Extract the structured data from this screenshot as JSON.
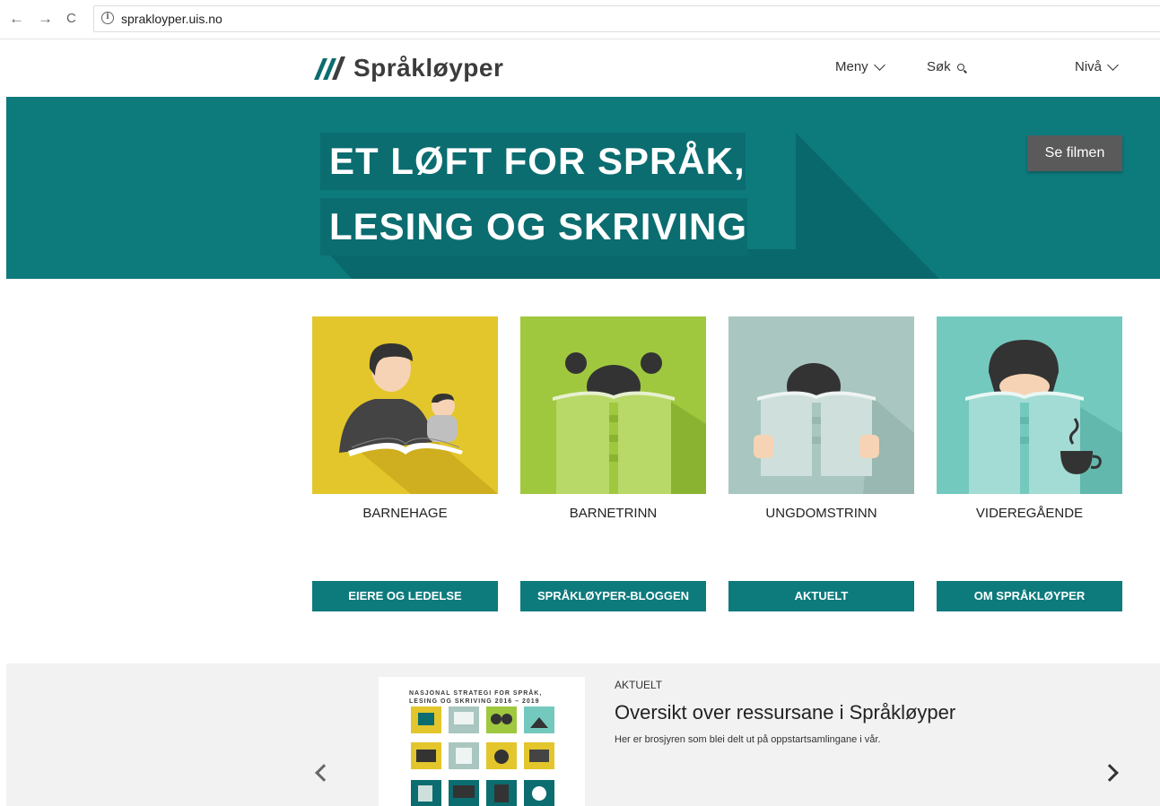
{
  "browser": {
    "back": "←",
    "forward": "→",
    "reload": "C",
    "url": "sprakloyper.uis.no"
  },
  "header": {
    "logo_text": "Språkløyper",
    "nav": {
      "menu": "Meny",
      "search": "Søk",
      "level": "Nivå"
    }
  },
  "hero": {
    "line1": "ET LØFT FOR SPRÅK,",
    "line2": "LESING OG SKRIVING",
    "button": "Se filmen"
  },
  "levels": [
    {
      "label": "BARNEHAGE",
      "color": "#e3c62b"
    },
    {
      "label": "BARNETRINN",
      "color": "#9fc83f"
    },
    {
      "label": "UNGDOMSTRINN",
      "color": "#a9c6c0"
    },
    {
      "label": "VIDEREGÅENDE",
      "color": "#74c9bf"
    }
  ],
  "buttons": [
    "EIERE OG LEDELSE",
    "SPRÅKLØYPER-BLOGGEN",
    "AKTUELT",
    "OM SPRÅKLØYPER"
  ],
  "news": {
    "poster_title": "NASJONAL STRATEGI FOR SPRÅK, LESING OG SKRIVING 2016 – 2019",
    "kicker": "AKTUELT",
    "title": "Oversikt over ressursane i Språkløyper",
    "text": "Her er brosjyren som blei delt ut på oppstartsamlingane i vår."
  },
  "colors": {
    "teal": "#0d7a7c",
    "teal_dark": "#0b6d70",
    "button_gray": "#5a5a5a",
    "carousel_bg": "#f2f2f2"
  }
}
